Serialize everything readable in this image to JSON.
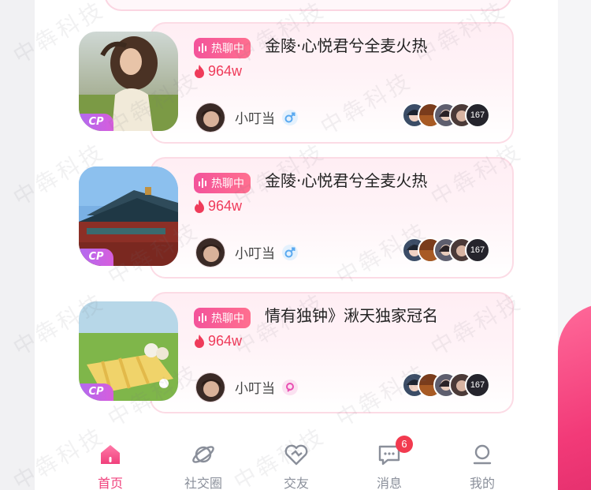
{
  "rooms": [
    {
      "status_label": "热聊中",
      "title": "金陵·心悦君兮全麦火热",
      "heat": "964w",
      "host_name": "小叮当",
      "host_gender_icon": "male-icon",
      "tag": "CP",
      "member_count": "167",
      "cover": "girl-outdoor-photo"
    },
    {
      "status_label": "热聊中",
      "title": "金陵·心悦君兮全麦火热",
      "heat": "964w",
      "host_name": "小叮当",
      "host_gender_icon": "male-icon",
      "tag": "CP",
      "member_count": "167",
      "cover": "palace-photo"
    },
    {
      "status_label": "热聊中",
      "title": "情有独钟》湫天独家冠名",
      "heat": "964w",
      "host_name": "小叮当",
      "host_gender_icon": "female-icon",
      "tag": "CP",
      "member_count": "167",
      "cover": "picnic-photo"
    }
  ],
  "tabbar": {
    "items": [
      {
        "label": "首页",
        "icon": "home-icon",
        "active": true
      },
      {
        "label": "社交圈",
        "icon": "planet-icon",
        "active": false
      },
      {
        "label": "交友",
        "icon": "heart-icon",
        "active": false
      },
      {
        "label": "消息",
        "icon": "chat-icon",
        "active": false,
        "badge": "6"
      },
      {
        "label": "我的",
        "icon": "profile-icon",
        "active": false
      }
    ]
  },
  "watermark": "中犇科技",
  "colors": {
    "accent": "#f0407c",
    "heat": "#ef3b5a",
    "male": "#5aa9f0",
    "female": "#e94fb2",
    "cp_badge": "#c062e6"
  }
}
